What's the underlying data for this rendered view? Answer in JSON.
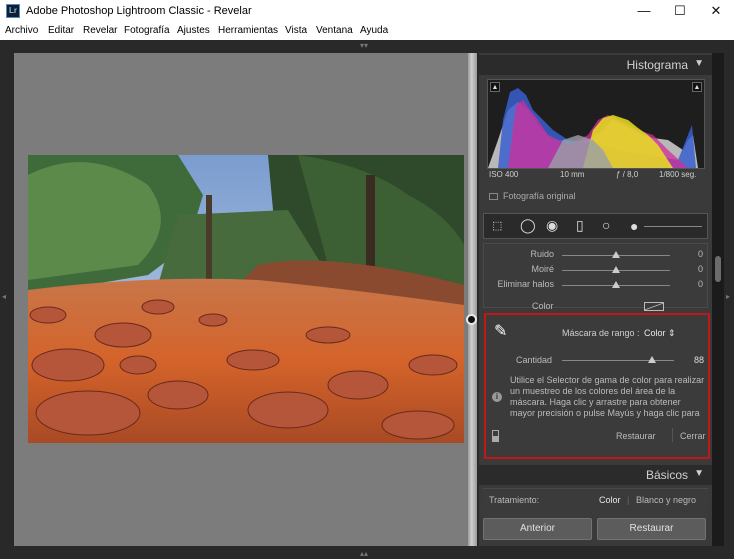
{
  "window": {
    "app_icon": "Lr",
    "title": "Adobe Photoshop Lightroom Classic - Revelar",
    "controls": {
      "minimize": "—",
      "maximize": "☐",
      "close": "✕"
    }
  },
  "menu": [
    "Archivo",
    "Editar",
    "Revelar",
    "Fotografía",
    "Ajustes",
    "Herramientas",
    "Vista",
    "Ventana",
    "Ayuda"
  ],
  "histogram": {
    "title": "Histograma",
    "iso": "ISO 400",
    "focal": "10 mm",
    "aperture": "ƒ / 8,0",
    "shutter": "1/800 seg.",
    "original_photo": "Fotografía original"
  },
  "detail": {
    "sliders": [
      {
        "label": "Ruido",
        "value": "0",
        "position": 0.5
      },
      {
        "label": "Moiré",
        "value": "0",
        "position": 0.5
      },
      {
        "label": "Eliminar halos",
        "value": "0",
        "position": 0.5
      }
    ],
    "color_label": "Color"
  },
  "range_mask": {
    "label": "Máscara de rango :",
    "value": "Color ⇕",
    "amount_label": "Cantidad",
    "amount_value": "88",
    "amount_fraction": 0.88,
    "info": "Utilice el Selector de gama de color para realizar un muestreo de los colores del área de la máscara. Haga clic y arrastre para obtener mayor precisión o pulse Mayús y haga clic para",
    "reset": "Restaurar",
    "close": "Cerrar"
  },
  "basicos": {
    "title": "Básicos",
    "treatment_label": "Tratamiento:",
    "treatment_color": "Color",
    "treatment_bw": "Blanco y negro"
  },
  "buttons": {
    "previous": "Anterior",
    "reset": "Restaurar"
  },
  "colors": {
    "mask_border": "#c01818",
    "panel_bg": "#3a3a3a",
    "preview_bg": "#7c7c7c"
  }
}
